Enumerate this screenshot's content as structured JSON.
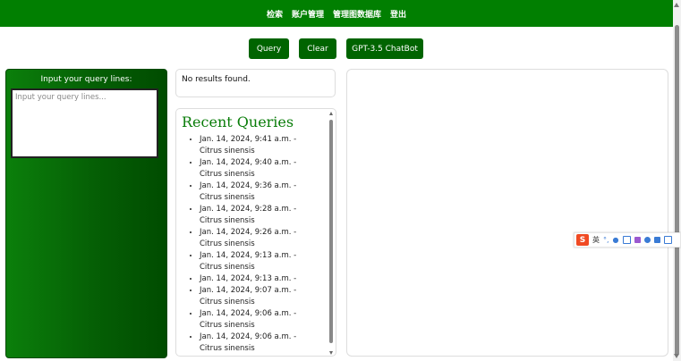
{
  "nav": {
    "items": [
      {
        "label": "检索"
      },
      {
        "label": "账户管理"
      },
      {
        "label": "管理图数据库"
      },
      {
        "label": "登出"
      }
    ]
  },
  "actions": {
    "query_label": "Query",
    "clear_label": "Clear",
    "chatbot_label": "GPT-3.5 ChatBot"
  },
  "query_panel": {
    "title": "Input your query lines:",
    "placeholder": "Input your query lines..."
  },
  "results": {
    "message": "No results found."
  },
  "recent": {
    "title": "Recent Queries",
    "items": [
      {
        "text": "Jan. 14, 2024, 9:41 a.m. - Citrus sinensis"
      },
      {
        "text": "Jan. 14, 2024, 9:40 a.m. - Citrus sinensis"
      },
      {
        "text": "Jan. 14, 2024, 9:36 a.m. - Citrus sinensis"
      },
      {
        "text": "Jan. 14, 2024, 9:28 a.m. - Citrus sinensis"
      },
      {
        "text": "Jan. 14, 2024, 9:26 a.m. - Citrus sinensis"
      },
      {
        "text": "Jan. 14, 2024, 9:13 a.m. - Citrus sinensis"
      },
      {
        "text": "Jan. 14, 2024, 9:13 a.m. -"
      },
      {
        "text": "Jan. 14, 2024, 9:07 a.m. - Citrus sinensis"
      },
      {
        "text": "Jan. 14, 2024, 9:06 a.m. - Citrus sinensis"
      },
      {
        "text": "Jan. 14, 2024, 9:06 a.m. - Citrus sinensis"
      }
    ]
  },
  "ime_toolbar": {
    "logo": "S",
    "mode": "英",
    "icons": [
      "punctuation-icon",
      "microphone-icon",
      "keyboard-icon",
      "skin-icon",
      "emoji-icon",
      "toolbox-icon",
      "menu-icon"
    ]
  },
  "colors": {
    "brand_green": "#017f01",
    "button_green": "#006400",
    "title_green": "#0a7d0a"
  }
}
